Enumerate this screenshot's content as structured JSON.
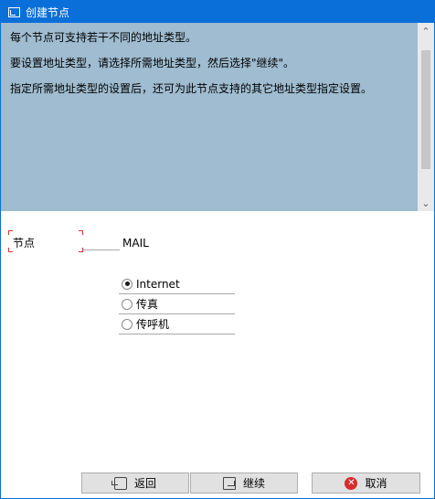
{
  "window": {
    "title": "创建节点"
  },
  "info": {
    "lines": [
      "每个节点可支持若干不同的地址类型。",
      "要设置地址类型，请选择所需地址类型，然后选择\"继续\"。",
      "指定所需地址类型的设置后，还可为此节点支持的其它地址类型指定设置。"
    ]
  },
  "form": {
    "node_label": "节点",
    "node_value": "MAIL"
  },
  "address_types": {
    "options": [
      "Internet",
      "传真",
      "传呼机"
    ],
    "selected": "Internet"
  },
  "buttons": {
    "back": "返回",
    "continue": "继续",
    "cancel": "取消"
  },
  "icons": {
    "title": "window-icon",
    "back": "back-icon",
    "continue": "continue-icon",
    "cancel": "cancel-icon"
  },
  "colors": {
    "titlebar": "#0a6fd8",
    "info_panel": "#9fbcd0",
    "required_marker": "#d33333"
  }
}
